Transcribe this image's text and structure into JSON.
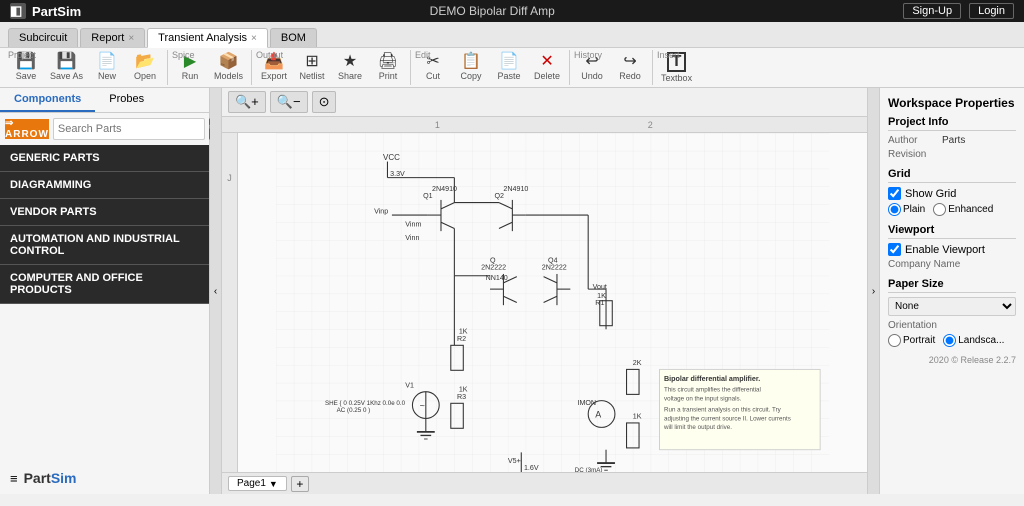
{
  "topbar": {
    "logo_text": "PartSim",
    "title": "DEMO Bipolar Diff Amp",
    "signup_label": "Sign-Up",
    "login_label": "Login"
  },
  "tabs": [
    {
      "label": "Subcircuit",
      "closable": false,
      "active": false
    },
    {
      "label": "Report",
      "closable": true,
      "active": false
    },
    {
      "label": "Transient Analysis",
      "closable": true,
      "active": false
    },
    {
      "label": "BOM",
      "closable": false,
      "active": false
    }
  ],
  "toolbar": {
    "groups": [
      {
        "label": "Project",
        "items": [
          {
            "icon": "💾",
            "label": "Save"
          },
          {
            "icon": "💾",
            "label": "Save As"
          },
          {
            "icon": "📄",
            "label": "New"
          },
          {
            "icon": "📂",
            "label": "Open"
          }
        ]
      },
      {
        "label": "Spice",
        "items": [
          {
            "icon": "▶",
            "label": "Run"
          },
          {
            "icon": "📦",
            "label": "Models"
          }
        ]
      },
      {
        "label": "Output",
        "items": [
          {
            "icon": "📤",
            "label": "Export"
          },
          {
            "icon": "🔲",
            "label": "Netlist"
          },
          {
            "icon": "★",
            "label": "Share"
          },
          {
            "icon": "🖨",
            "label": "Print"
          }
        ]
      },
      {
        "label": "Edit",
        "items": [
          {
            "icon": "✂",
            "label": "Cut"
          },
          {
            "icon": "📋",
            "label": "Copy"
          },
          {
            "icon": "📄",
            "label": "Paste"
          },
          {
            "icon": "✕",
            "label": "Delete"
          }
        ]
      },
      {
        "label": "History",
        "items": [
          {
            "icon": "↩",
            "label": "Undo"
          },
          {
            "icon": "↪",
            "label": "Redo"
          }
        ]
      },
      {
        "label": "Insert",
        "items": [
          {
            "icon": "T",
            "label": "Textbox"
          }
        ]
      }
    ]
  },
  "panel": {
    "tabs": [
      "Components",
      "Probes"
    ],
    "active_tab": "Components",
    "search_placeholder": "Search Parts",
    "arrow_label": "ARROW",
    "categories": [
      "GENERIC PARTS",
      "DIAGRAMMING",
      "VENDOR PARTS",
      "AUTOMATION AND INDUSTRIAL CONTROL",
      "COMPUTER AND OFFICE PRODUCTS"
    ],
    "logo_text1": "Part",
    "logo_text2": "Sim"
  },
  "canvas": {
    "zoom_in": "+",
    "zoom_out": "-",
    "zoom_reset": "⊙",
    "page_label": "Page1",
    "add_page": "+"
  },
  "workspace": {
    "title": "Workspace Properties",
    "project_info": {
      "title": "Project Info",
      "author_label": "Author",
      "author_value": "Parts",
      "revision_label": "Revision",
      "revision_value": ""
    },
    "grid": {
      "title": "Grid",
      "show_grid": true,
      "show_grid_label": "Show Grid",
      "options": [
        "Plain",
        "Enhanced"
      ],
      "selected": "Plain"
    },
    "viewport": {
      "title": "Viewport",
      "enable_viewport": true,
      "enable_viewport_label": "Enable Viewport",
      "company_name_label": "Company Name",
      "company_name_value": ""
    },
    "paper_size": {
      "title": "Paper Size",
      "value": "None",
      "orientation_label": "Orientation",
      "options": [
        "Portrait",
        "Landscape"
      ],
      "selected": "Landscape"
    },
    "footer": "2020 © Release 2.2.7"
  },
  "circuit_description": {
    "title": "Bipolar differential amplifier.",
    "line1": "This circuit amplifies the differential voltage on the input signals.",
    "line2": "Run a transient analysis on this circuit. Try adjusting the current source II. Lower currents will limit the output drive."
  }
}
